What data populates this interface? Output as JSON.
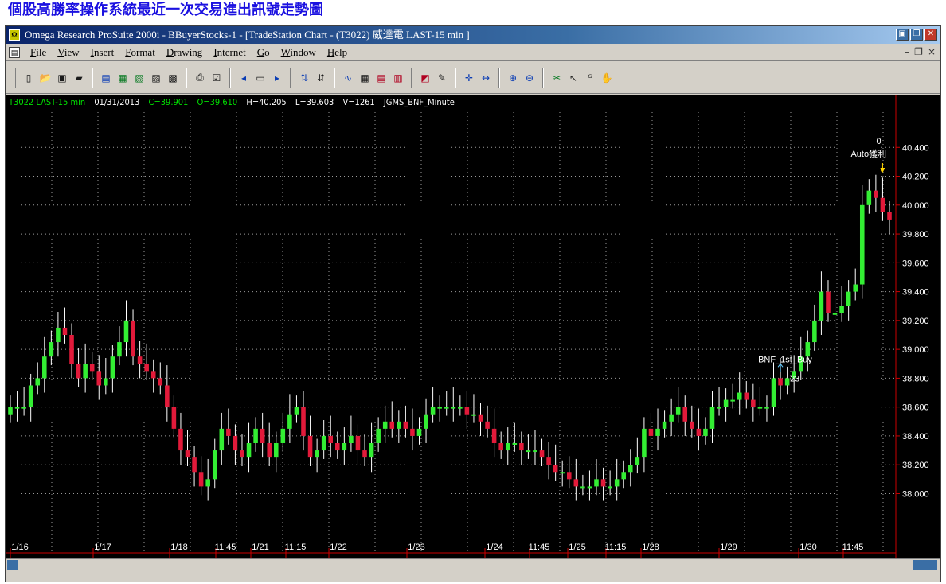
{
  "page_title": "個股高勝率操作系統最近一次交易進出訊號走勢圖",
  "window": {
    "title": "Omega Research ProSuite 2000i - BBuyerStocks-1 - [TradeStation Chart - (T3022) 威達電 LAST-15 min ]",
    "app_icon": "omega-icon",
    "buttons": [
      "minimize-icon",
      "restore-icon",
      "close-icon"
    ]
  },
  "menu": {
    "doc_icon": "chart-document-icon",
    "items": [
      "File",
      "View",
      "Insert",
      "Format",
      "Drawing",
      "Internet",
      "Go",
      "Window",
      "Help"
    ]
  },
  "toolbar": {
    "icons": [
      "new-icon",
      "open-icon",
      "save-icon",
      "open-folder-icon",
      "sep",
      "chart-window-icon",
      "doc-a-icon",
      "doc-b-icon",
      "doc-c-icon",
      "doc-d-icon",
      "sep",
      "print-icon",
      "properties-icon",
      "sep",
      "zoom-back-icon",
      "zoom-page-icon",
      "zoom-fwd-icon",
      "sep",
      "strategy-a-icon",
      "strategy-b-icon",
      "sep",
      "indicator-icon",
      "grid-a-icon",
      "grid-b-icon",
      "grid-c-icon",
      "sep",
      "chart-type-icon",
      "format-icon",
      "sep",
      "cursor-cross-icon",
      "spacing-icon",
      "sep",
      "zoom-in-icon",
      "zoom-out-icon",
      "sep",
      "tools-icon",
      "pointer-icon",
      "data-window-icon",
      "hand-icon"
    ]
  },
  "status": {
    "symbol": "T3022 LAST-15 min",
    "date": "01/31/2013",
    "close": "C=39.901",
    "open": "O=39.610",
    "high": "H=40.205",
    "low": "L=39.603",
    "volume": "V=1261",
    "strategy": "JGMS_BNF_Minute"
  },
  "colors": {
    "up": "#33ee33",
    "down": "#e21a3a",
    "grid": "#9a9a9a",
    "axis": "#cc0000",
    "text": "#ffffff"
  },
  "chart_data": {
    "type": "candlestick",
    "ylim": [
      37.6,
      40.6
    ],
    "yticks": [
      "40.400",
      "40.200",
      "40.000",
      "39.800",
      "39.600",
      "39.400",
      "39.200",
      "39.000",
      "38.800",
      "38.600",
      "38.400",
      "38.200",
      "38.000"
    ],
    "xticks": [
      "1/16",
      "1/17",
      "1/18",
      "11:45",
      "1/21",
      "11:15",
      "1/22",
      "1/23",
      "1/24",
      "11:45",
      "1/25",
      "11:15",
      "1/28",
      "1/29",
      "1/30",
      "11:45"
    ],
    "annotations": {
      "buy_label": "BNF_1st_Buy",
      "buy_qty": "23",
      "exit_label": "Auto獲利",
      "exit_qty": "0"
    },
    "closes": [
      38.6,
      38.6,
      38.6,
      38.75,
      38.8,
      38.95,
      39.05,
      39.15,
      39.1,
      38.9,
      38.8,
      38.9,
      38.85,
      38.75,
      38.8,
      38.95,
      39.05,
      39.2,
      38.95,
      38.9,
      38.85,
      38.8,
      38.75,
      38.6,
      38.45,
      38.3,
      38.25,
      38.15,
      38.05,
      38.1,
      38.3,
      38.45,
      38.4,
      38.3,
      38.25,
      38.35,
      38.45,
      38.35,
      38.25,
      38.35,
      38.45,
      38.55,
      38.6,
      38.4,
      38.25,
      38.3,
      38.4,
      38.35,
      38.3,
      38.35,
      38.4,
      38.3,
      38.25,
      38.35,
      38.45,
      38.5,
      38.45,
      38.5,
      38.45,
      38.4,
      38.45,
      38.55,
      38.6,
      38.6,
      38.6,
      38.6,
      38.6,
      38.55,
      38.55,
      38.5,
      38.45,
      38.35,
      38.3,
      38.35,
      38.35,
      38.3,
      38.3,
      38.3,
      38.25,
      38.2,
      38.15,
      38.15,
      38.1,
      38.05,
      38.05,
      38.05,
      38.1,
      38.05,
      38.05,
      38.1,
      38.15,
      38.2,
      38.25,
      38.45,
      38.4,
      38.45,
      38.5,
      38.55,
      38.6,
      38.5,
      38.45,
      38.4,
      38.45,
      38.6,
      38.6,
      38.65,
      38.65,
      38.7,
      38.65,
      38.6,
      38.6,
      38.6,
      38.8,
      38.75,
      38.8,
      38.85,
      38.95,
      39.05,
      39.2,
      39.4,
      39.25,
      39.25,
      39.3,
      39.4,
      39.45,
      40.0,
      40.1,
      40.05,
      39.95,
      39.9
    ]
  }
}
